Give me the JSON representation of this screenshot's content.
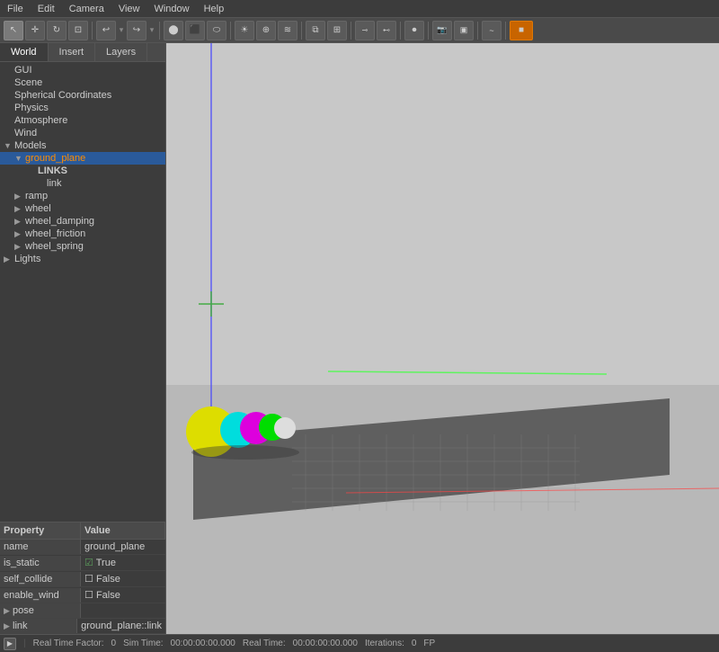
{
  "menubar": {
    "items": [
      "File",
      "Edit",
      "Camera",
      "View",
      "Window",
      "Help"
    ]
  },
  "toolbar": {
    "tools": [
      {
        "name": "select",
        "icon": "↖",
        "active": true
      },
      {
        "name": "translate",
        "icon": "✛"
      },
      {
        "name": "rotate",
        "icon": "↻"
      },
      {
        "name": "scale",
        "icon": "⊡"
      },
      {
        "name": "undo",
        "icon": "↩"
      },
      {
        "name": "sep1",
        "icon": ""
      },
      {
        "name": "redo",
        "icon": "↪"
      },
      {
        "name": "sep2",
        "icon": ""
      },
      {
        "name": "sphere",
        "icon": "●"
      },
      {
        "name": "box",
        "icon": "▪"
      },
      {
        "name": "cylinder",
        "icon": "⬭"
      },
      {
        "name": "pointlight",
        "icon": "☀"
      },
      {
        "name": "spotlight",
        "icon": "⊕"
      },
      {
        "name": "dirlight",
        "icon": "≋"
      },
      {
        "name": "sep3",
        "icon": ""
      },
      {
        "name": "copy",
        "icon": "⧉"
      },
      {
        "name": "paste",
        "icon": "📋"
      },
      {
        "name": "sep4",
        "icon": ""
      },
      {
        "name": "jointtype",
        "icon": "⊸"
      },
      {
        "name": "joint",
        "icon": "⊷"
      },
      {
        "name": "sep5",
        "icon": ""
      },
      {
        "name": "record",
        "icon": "⏺"
      },
      {
        "name": "sep6",
        "icon": ""
      },
      {
        "name": "plot",
        "icon": "📈"
      },
      {
        "name": "sep7",
        "icon": ""
      },
      {
        "name": "screenshot",
        "icon": "📷"
      },
      {
        "name": "video",
        "icon": "🎥"
      },
      {
        "name": "sep8",
        "icon": ""
      },
      {
        "name": "graph",
        "icon": "~"
      },
      {
        "name": "sep9",
        "icon": ""
      },
      {
        "name": "orange-btn",
        "icon": "■"
      }
    ]
  },
  "tabs": {
    "items": [
      "World",
      "Insert",
      "Layers"
    ]
  },
  "world_tree": {
    "items": [
      {
        "id": "gui",
        "label": "GUI",
        "level": 1,
        "hasArrow": false
      },
      {
        "id": "scene",
        "label": "Scene",
        "level": 1,
        "hasArrow": false
      },
      {
        "id": "spherical",
        "label": "Spherical Coordinates",
        "level": 1,
        "hasArrow": false
      },
      {
        "id": "physics",
        "label": "Physics",
        "level": 1,
        "hasArrow": false
      },
      {
        "id": "atmosphere",
        "label": "Atmosphere",
        "level": 1,
        "hasArrow": false
      },
      {
        "id": "wind",
        "label": "Wind",
        "level": 1,
        "hasArrow": false
      },
      {
        "id": "models",
        "label": "Models",
        "level": 1,
        "hasArrow": true,
        "expanded": true
      },
      {
        "id": "ground_plane",
        "label": "ground_plane",
        "level": 2,
        "hasArrow": true,
        "expanded": true,
        "orange": true,
        "selected": true
      },
      {
        "id": "links",
        "label": "LINKS",
        "level": 3,
        "hasArrow": false,
        "bold": true
      },
      {
        "id": "link",
        "label": "link",
        "level": 4,
        "hasArrow": false
      },
      {
        "id": "ramp",
        "label": "ramp",
        "level": 2,
        "hasArrow": true,
        "expanded": false
      },
      {
        "id": "wheel",
        "label": "wheel",
        "level": 2,
        "hasArrow": true,
        "expanded": false
      },
      {
        "id": "wheel_damping",
        "label": "wheel_damping",
        "level": 2,
        "hasArrow": true,
        "expanded": false
      },
      {
        "id": "wheel_friction",
        "label": "wheel_friction",
        "level": 2,
        "hasArrow": true,
        "expanded": false
      },
      {
        "id": "wheel_spring",
        "label": "wheel_spring",
        "level": 2,
        "hasArrow": true,
        "expanded": false
      },
      {
        "id": "lights",
        "label": "Lights",
        "level": 1,
        "hasArrow": true,
        "expanded": false
      }
    ]
  },
  "properties": {
    "header": {
      "col1": "Property",
      "col2": "Value"
    },
    "rows": [
      {
        "name": "name",
        "value": "ground_plane",
        "type": "text",
        "expandable": false
      },
      {
        "name": "is_static",
        "value": "True",
        "type": "checkbox_true",
        "expandable": false
      },
      {
        "name": "self_collide",
        "value": "False",
        "type": "checkbox_false",
        "expandable": false
      },
      {
        "name": "enable_wind",
        "value": "False",
        "type": "checkbox_false",
        "expandable": false
      },
      {
        "name": "pose",
        "value": "",
        "type": "expandable",
        "expandable": true
      },
      {
        "name": "link",
        "value": "ground_plane::link",
        "type": "expandable",
        "expandable": true
      }
    ]
  },
  "statusbar": {
    "play_label": "▶",
    "rtf_label": "Real Time Factor:",
    "rtf_value": "0",
    "sim_label": "Sim Time:",
    "sim_value": "00:00:00:00.000",
    "real_label": "Real Time:",
    "real_value": "00:00:00:00.000",
    "iter_label": "Iterations:",
    "iter_value": "0",
    "fps_label": "FP"
  },
  "colors": {
    "background": "#1e1e1e",
    "ground": "#555555",
    "grid": "#888888",
    "axis_blue": "#4444ff",
    "axis_green": "#44ff44",
    "axis_red": "#ff4444"
  }
}
